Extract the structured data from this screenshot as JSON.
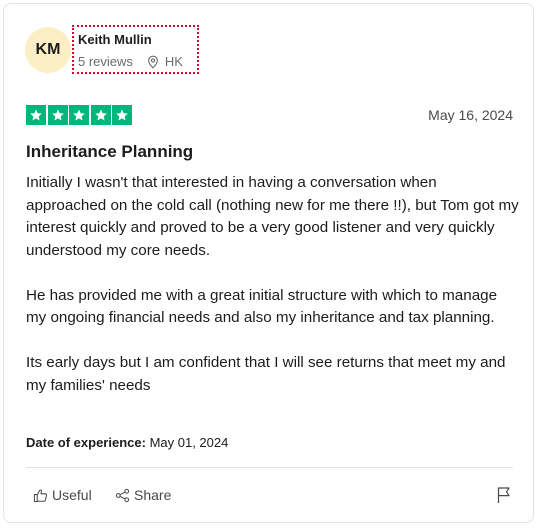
{
  "reviewer": {
    "initials": "KM",
    "name": "Keith Mullin",
    "reviews": "5 reviews",
    "location": "HK"
  },
  "rating": {
    "stars": 5,
    "max": 5,
    "color": "#00b67a"
  },
  "review": {
    "date": "May 16, 2024",
    "title": "Inheritance Planning",
    "paragraphs": [
      "Initially I wasn't that interested in having a conversation when approached on the cold call (nothing new for me there !!), but Tom got my interest quickly and proved to be a very good listener and very quickly understood my core needs.",
      "He has provided me with a great initial structure with which to manage my ongoing financial needs and also my inheritance and tax planning.",
      "Its early days but I am confident that I will see returns that meet my and my families' needs"
    ],
    "experience_label": "Date of experience:",
    "experience_date": "May 01, 2024"
  },
  "actions": {
    "useful_label": "Useful",
    "share_label": "Share",
    "icons": [
      "thumbs-up-icon",
      "share-icon",
      "flag-icon",
      "location-pin-icon",
      "star-icon"
    ]
  }
}
